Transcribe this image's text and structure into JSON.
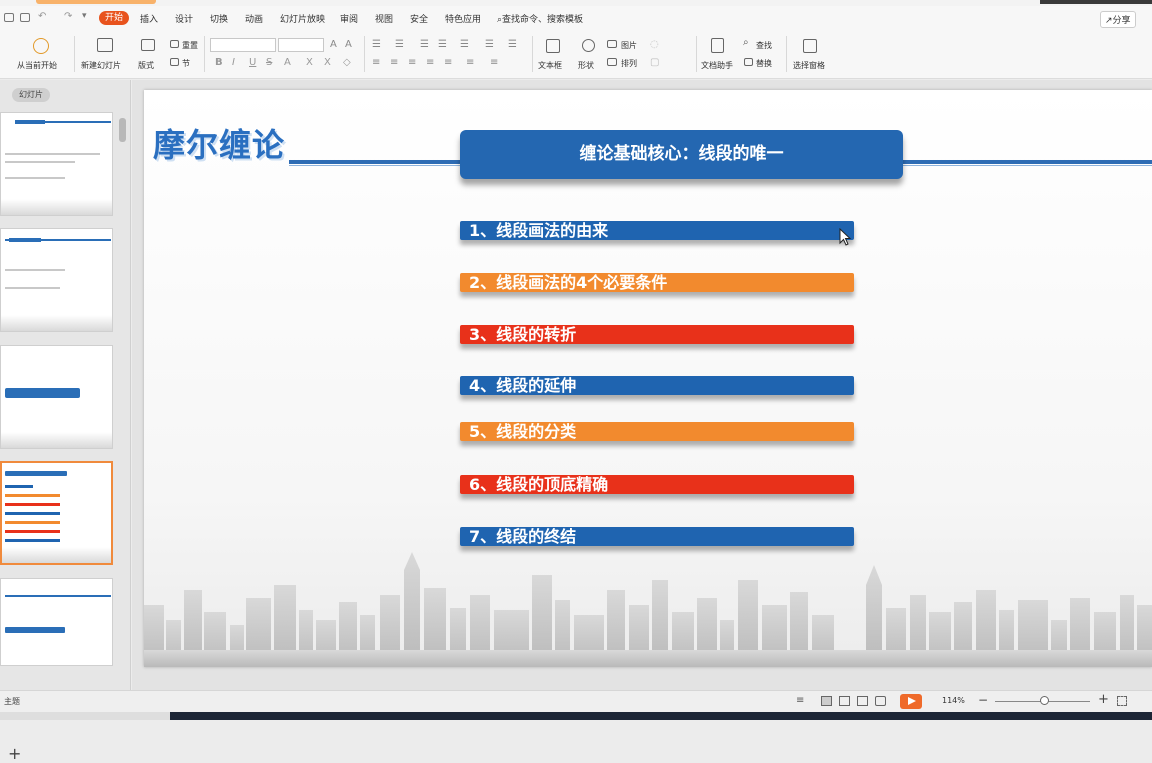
{
  "menu": {
    "tabs": [
      "开始",
      "插入",
      "设计",
      "切换",
      "动画",
      "幻灯片放映",
      "审阅",
      "视图",
      "安全",
      "特色应用"
    ],
    "search": "查找命令、搜索模板",
    "share": "分享"
  },
  "ribbon": {
    "from_current": "从当前开始",
    "new_slide": "新建幻灯片",
    "layout": "版式",
    "reset": "重置",
    "section": "节",
    "textbox": "文本框",
    "shape": "形状",
    "picture": "图片",
    "arrange": "排列",
    "doc_helper": "文档助手",
    "find": "查找",
    "replace": "替换",
    "select_pane": "选择窗格"
  },
  "panel": {
    "tab": "幻灯片"
  },
  "slide": {
    "logo_text": "摩尔缠论",
    "title": "缠论基础核心：线段的唯一",
    "items": [
      {
        "text": "1、线段画法的由来",
        "color": "#1f64b0"
      },
      {
        "text": "2、线段画法的4个必要条件",
        "color": "#f28a2e"
      },
      {
        "text": "3、线段的转折",
        "color": "#e8311a"
      },
      {
        "text": "4、线段的延伸",
        "color": "#1f64b0"
      },
      {
        "text": "5、线段的分类",
        "color": "#f28a2e"
      },
      {
        "text": "6、线段的顶底精确",
        "color": "#e8311a"
      },
      {
        "text": "7、线段的终结",
        "color": "#1f64b0"
      }
    ]
  },
  "status": {
    "theme": "主题",
    "zoom": "114%"
  },
  "colors": {
    "accent": "#e8531d",
    "blue": "#1f64b0",
    "orange": "#f28a2e",
    "red": "#e8311a"
  }
}
